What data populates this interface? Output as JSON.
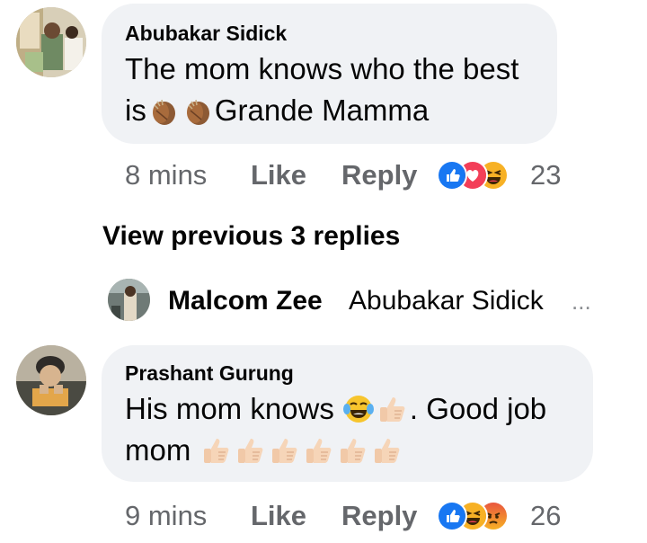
{
  "comments": [
    {
      "author": "Abubakar Sidick",
      "line1": "The mom knows who the best",
      "line2_a": "is",
      "line2_b": "Grande Mamma",
      "time": "8 mins",
      "like": "Like",
      "reply": "Reply",
      "reaction_count": "23",
      "reactions": [
        "like-icon",
        "love-icon",
        "haha-icon"
      ]
    },
    {
      "author": "Prashant Gurung",
      "line1_a": "His mom knows",
      "line1_b": ". Good job",
      "line2": "mom",
      "time": "9 mins",
      "like": "Like",
      "reply": "Reply",
      "reaction_count": "26",
      "reactions": [
        "like-icon",
        "haha-icon",
        "angry-icon"
      ]
    }
  ],
  "view_previous": "View previous 3 replies",
  "reply_preview": {
    "author": "Malcom Zee",
    "text": "Abubakar Sidick",
    "ellipsis": "..."
  },
  "colors": {
    "bubble": "#f0f2f5",
    "meta_text": "#65676b",
    "like_blue": "#1877f2",
    "love_red": "#f33e58",
    "haha_yellow": "#f7b125"
  }
}
